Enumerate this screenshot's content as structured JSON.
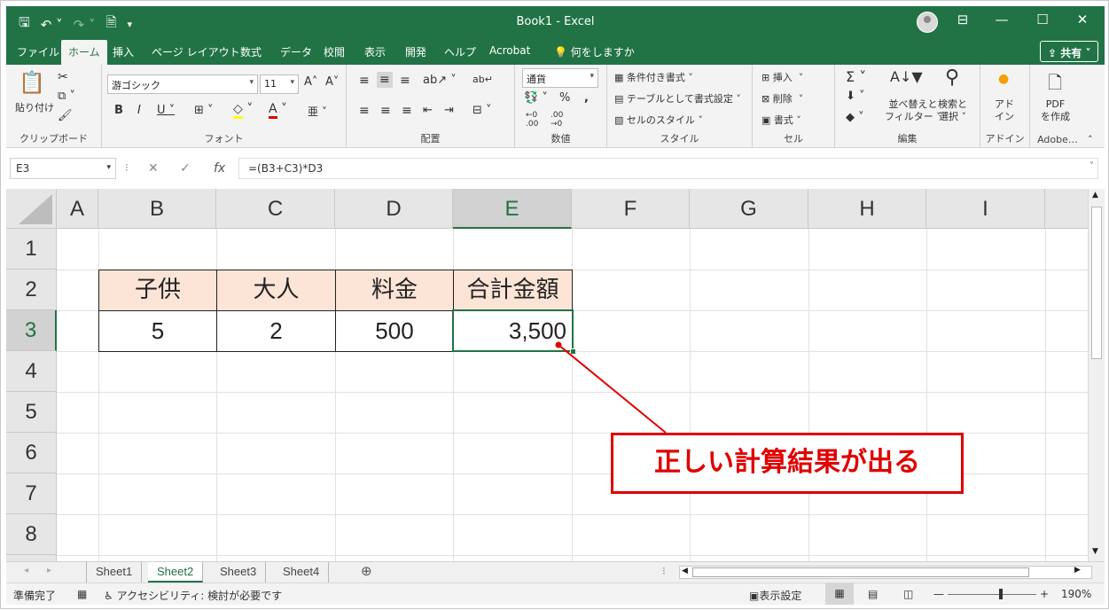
{
  "window": {
    "file_name": "Book1",
    "separator": "-",
    "app_name": "Excel",
    "share_label": "共有"
  },
  "menu_tabs": [
    "ファイル",
    "ホーム",
    "挿入",
    "ページ レイアウト",
    "数式",
    "データ",
    "校閲",
    "表示",
    "開発",
    "ヘルプ",
    "Acrobat"
  ],
  "tell_me": "何をしますか",
  "ribbon": {
    "clipboard": {
      "paste": "貼り付け",
      "label": "クリップボード"
    },
    "font": {
      "name": "游ゴシック",
      "size": "11",
      "label": "フォント"
    },
    "alignment": {
      "label": "配置"
    },
    "number": {
      "format": "通貨",
      "label": "数値"
    },
    "styles": {
      "conditional": "条件付き書式",
      "table": "テーブルとして書式設定",
      "cell_styles": "セルのスタイル",
      "label": "スタイル"
    },
    "cells": {
      "insert": "挿入",
      "delete": "削除",
      "format": "書式",
      "label": "セル"
    },
    "editing": {
      "sort_line1": "並べ替えと",
      "sort_line2": "フィルター",
      "find_line1": "検索と",
      "find_line2": "選択",
      "label": "編集"
    },
    "addins": {
      "line1": "アド",
      "line2": "イン",
      "label": "アドイン"
    },
    "adobe": {
      "line1": "PDF",
      "line2": "を作成",
      "label": "Adobe…"
    }
  },
  "formula_bar": {
    "name_box": "E3",
    "formula": "=(B3+C3)*D3"
  },
  "grid": {
    "columns": [
      "A",
      "B",
      "C",
      "D",
      "E",
      "F",
      "G",
      "H",
      "I"
    ],
    "rows": [
      "1",
      "2",
      "3",
      "4",
      "5",
      "6",
      "7",
      "8"
    ],
    "selected_column": "E",
    "selected_row": "3",
    "headers": [
      "子供",
      "大人",
      "料金",
      "合計金額"
    ],
    "values": [
      "5",
      "2",
      "500",
      "3,500"
    ]
  },
  "callout": "正しい計算結果が出る",
  "sheets": [
    "Sheet1",
    "Sheet2",
    "Sheet3",
    "Sheet4"
  ],
  "active_sheet": "Sheet2",
  "status_bar": {
    "ready": "準備完了",
    "accessibility": "アクセシビリティ: 検討が必要です",
    "display_settings": "表示設定",
    "zoom": "190%"
  },
  "colors": {
    "excel_green": "#217346",
    "header_fill": "#fce4d6",
    "callout_red": "#e00000"
  }
}
